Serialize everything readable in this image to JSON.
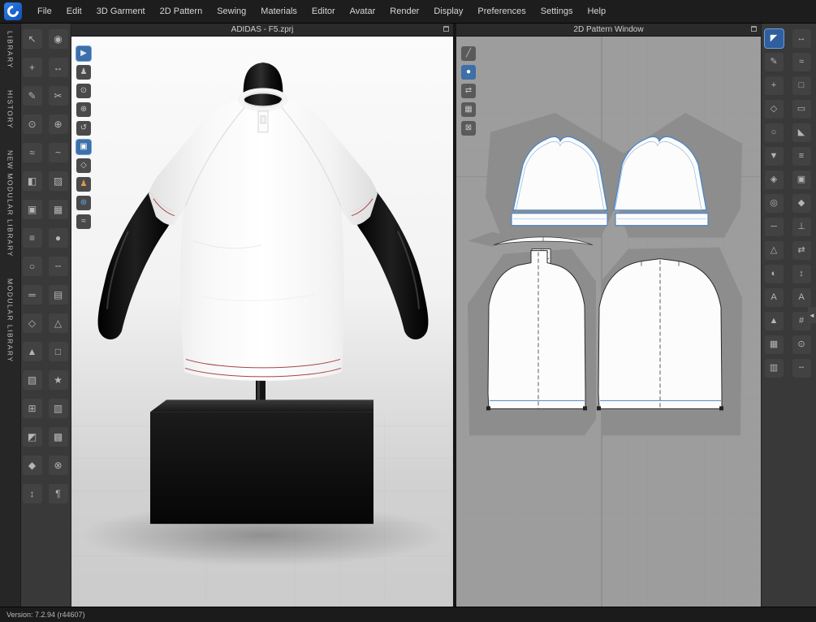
{
  "menubar": {
    "items": [
      "File",
      "Edit",
      "3D Garment",
      "2D Pattern",
      "Sewing",
      "Materials",
      "Editor",
      "Avatar",
      "Render",
      "Display",
      "Preferences",
      "Settings",
      "Help"
    ]
  },
  "sidebar": {
    "tabs": [
      "LIBRARY",
      "HISTORY",
      "NEW MODULAR LIBRARY",
      "MODULAR LIBRARY"
    ]
  },
  "panels": {
    "viewport": {
      "title": "ADIDAS - F5.zprj"
    },
    "pattern2d": {
      "title": "2D Pattern Window"
    }
  },
  "statusbar": {
    "version": "Version: 7.2.94 (r44607)"
  },
  "colors": {
    "accent_selection": "#4a86c8",
    "active_tool": "#2f5f9e",
    "garment_stripe_red": "#a84444",
    "pattern_canvas_bg": "#9d9d9d",
    "silhouette_gray": "#8d8d8d",
    "toolbar_bg": "#393939"
  },
  "toolbars": {
    "left": {
      "icons": [
        {
          "n": "select-move-icon",
          "g": "↖"
        },
        {
          "n": "avatar-display-icon",
          "g": "◉"
        },
        {
          "n": "add-point-icon",
          "g": "+"
        },
        {
          "n": "measure-avatar-icon",
          "g": "↔"
        },
        {
          "n": "pen-tool-icon",
          "g": "✎"
        },
        {
          "n": "scissors-icon",
          "g": "✂"
        },
        {
          "n": "pin-tool-icon",
          "g": "⊙"
        },
        {
          "n": "tack-on-avatar-icon",
          "g": "⊕"
        },
        {
          "n": "segment-sewing-icon",
          "g": "≈"
        },
        {
          "n": "free-sewing-icon",
          "g": "~"
        },
        {
          "n": "fold-arrangement-icon",
          "g": "◧"
        },
        {
          "n": "steam-brush-icon",
          "g": "▨"
        },
        {
          "n": "solidify-icon",
          "g": "▣"
        },
        {
          "n": "bonding-tool-icon",
          "g": "▦"
        },
        {
          "n": "zipper-icon",
          "g": "≡"
        },
        {
          "n": "button-icon",
          "g": "●"
        },
        {
          "n": "buttonhole-icon",
          "g": "○"
        },
        {
          "n": "topstitch-icon",
          "g": "╌"
        },
        {
          "n": "piping-icon",
          "g": "═"
        },
        {
          "n": "puckering-icon",
          "g": "▤"
        },
        {
          "n": "flattening-icon",
          "g": "◇"
        },
        {
          "n": "trace-2d-icon",
          "g": "△"
        },
        {
          "n": "grading-icon",
          "g": "▲"
        },
        {
          "n": "pattern-outline-icon",
          "g": "□"
        },
        {
          "n": "texture-editor-icon",
          "g": "▧"
        },
        {
          "n": "graphic-tool-icon",
          "g": "★"
        },
        {
          "n": "uv-map-icon",
          "g": "⊞"
        },
        {
          "n": "print-layout-icon",
          "g": "▥"
        },
        {
          "n": "colorway-icon",
          "g": "◩"
        },
        {
          "n": "fabric-icon",
          "g": "▩"
        },
        {
          "n": "trim-icon",
          "g": "◆"
        },
        {
          "n": "hardware-icon",
          "g": "⊗"
        },
        {
          "n": "measure-tape-icon",
          "g": "↕"
        },
        {
          "n": "annotation-icon",
          "g": "¶"
        }
      ]
    },
    "viewport_overlay": {
      "icons": [
        {
          "n": "simulate-icon",
          "g": "▶",
          "a": true,
          "c": "#dcebfb",
          "bg": "#3d6fa8"
        },
        {
          "n": "show-avatar-icon",
          "g": "♟",
          "c": "#c0c0c0"
        },
        {
          "n": "arrangement-points-icon",
          "g": "⊙"
        },
        {
          "n": "show-x-ray-joints-icon",
          "g": "⊕"
        },
        {
          "n": "reset-pose-icon",
          "g": "↺"
        },
        {
          "n": "show-3d-garment-icon",
          "g": "▣",
          "a": true,
          "c": "#ffffff",
          "bg": "#3d6fa8"
        },
        {
          "n": "show-internal-lines-icon",
          "g": "◇"
        },
        {
          "n": "show-base-avatar-icon",
          "g": "♟",
          "c": "#e09a4e"
        },
        {
          "n": "show-environment-icon",
          "g": "⊕",
          "c": "#5aa0e0"
        },
        {
          "n": "show-wind-controller-icon",
          "g": "≈"
        }
      ]
    },
    "pattern_overlay": {
      "icons": [
        {
          "n": "slash-divide-icon",
          "g": "╱"
        },
        {
          "n": "show-3d-pattern-icon",
          "g": "●",
          "c": "#ffffff",
          "bg": "#3d6fa8"
        },
        {
          "n": "sync-2d-3d-icon",
          "g": "⇄"
        },
        {
          "n": "show-pattern-mesh-icon",
          "g": "▦"
        },
        {
          "n": "lock-pattern-icon",
          "g": "⊠"
        }
      ]
    },
    "right": {
      "icons": [
        {
          "n": "transform-pattern-icon",
          "g": "◤",
          "a": true
        },
        {
          "n": "move-pattern-icon",
          "g": "↔"
        },
        {
          "n": "edit-pattern-icon",
          "g": "✎"
        },
        {
          "n": "edit-curvature-icon",
          "g": "≈"
        },
        {
          "n": "add-point-split-icon",
          "g": "+"
        },
        {
          "n": "add-pattern-icon",
          "g": "□"
        },
        {
          "n": "polygon-tool-icon",
          "g": "◇"
        },
        {
          "n": "rectangle-tool-icon",
          "g": "▭"
        },
        {
          "n": "circle-tool-icon",
          "g": "○"
        },
        {
          "n": "dart-tool-icon",
          "g": "◣"
        },
        {
          "n": "notch-tool-icon",
          "g": "▼"
        },
        {
          "n": "seam-allowance-icon",
          "g": "≡"
        },
        {
          "n": "internal-polygon-icon",
          "g": "◈"
        },
        {
          "n": "internal-rectangle-icon",
          "g": "▣"
        },
        {
          "n": "internal-circle-icon",
          "g": "◎"
        },
        {
          "n": "internal-dart-icon",
          "g": "◆"
        },
        {
          "n": "base-line-icon",
          "g": "─"
        },
        {
          "n": "perpendicular-line-icon",
          "g": "⊥"
        },
        {
          "n": "trace-tool-icon",
          "g": "△"
        },
        {
          "n": "mirror-paste-icon",
          "g": "⇄"
        },
        {
          "n": "unfold-tool-icon",
          "g": "◐"
        },
        {
          "n": "walk-tool-icon",
          "g": "↕"
        },
        {
          "n": "text-tool-icon",
          "g": "A"
        },
        {
          "n": "annotation-tool-icon",
          "g": "A"
        },
        {
          "n": "grading-edit-icon",
          "g": "▲"
        },
        {
          "n": "measure-2d-icon",
          "g": "#"
        },
        {
          "n": "grid-toggle-icon",
          "g": "▦"
        },
        {
          "n": "snap-toggle-icon",
          "g": "⊙"
        },
        {
          "n": "layout-print-icon",
          "g": "▥"
        },
        {
          "n": "show-seamline-icon",
          "g": "╌"
        }
      ]
    }
  }
}
